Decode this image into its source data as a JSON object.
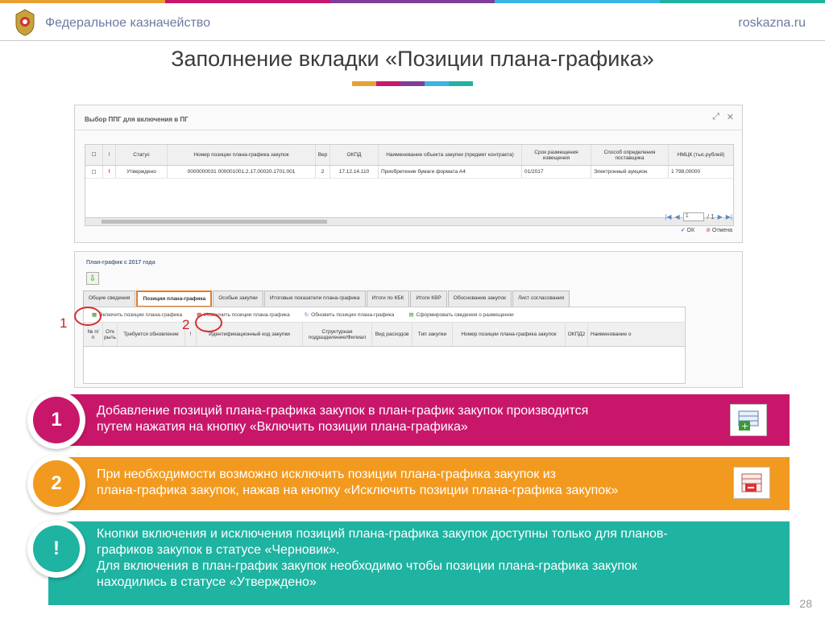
{
  "header": {
    "org_name": "Федеральное казначейство",
    "site_url": "roskazna.ru",
    "logo_icon": "coat-of-arms-emblem",
    "accent_colors": [
      "#e8a035",
      "#c8176b",
      "#7f3f98",
      "#3ab5e6",
      "#1fb3a1"
    ]
  },
  "slide": {
    "title": "Заполнение вкладки «Позиции плана-графика»",
    "page_number": "28"
  },
  "dialog": {
    "title": "Выбор ППГ для включения в ПГ",
    "columns": [
      "",
      "!",
      "Статус",
      "Номер позиции плана-графика закупок",
      "Вер",
      "ОКПД",
      "Наименование объекта закупки (предмет контракта)",
      "Срок размещения извещения",
      "Способ определения поставщика",
      "НМЦК (тыс.рублей)"
    ],
    "rows": [
      [
        "",
        "!",
        "Утверждено",
        "0000000031 000001001.2.17.00020.1701.001",
        "2",
        "17.12.14.110",
        "Приобретение бумаги формата А4",
        "01/2017",
        "Электронный аукцион",
        "1 798,00000"
      ]
    ],
    "pager": {
      "page": "1",
      "of": "/ 1"
    },
    "ok_label": "ОК",
    "cancel_label": "Отмена"
  },
  "form": {
    "title": "План-график с 2017 года",
    "tabs": [
      "Общие сведения",
      "Позиции плана-графика",
      "Особые закупки",
      "Итоговые показатели плана-графика",
      "Итоги по КБК",
      "Итоги КВР",
      "Обоснование закупок",
      "Лист согласования"
    ],
    "active_tab": 1,
    "toolbar": [
      "Включить позиции плана-графика",
      "Исключить позиции плана-графика",
      "Обновить позиции плана-графика",
      "Сформировать сведения о размещении"
    ],
    "columns": [
      "№ п/п",
      "Отк рыть",
      "Требуется обновление",
      "!",
      "Идентификационный код закупки",
      "Структурная подразделение/Филиал",
      "Вид расходов",
      "Тип закупки",
      "Номер позиции плана-графика закупок",
      "ОКПД2",
      "Наименование о"
    ],
    "markers": [
      "1",
      "2"
    ]
  },
  "bands": [
    {
      "badge": "1",
      "color": "#c8176b",
      "lines": [
        "Добавление позиций плана-графика закупок в план-график закупок производится",
        "путем нажатия на кнопку «Включить позиции плана-графика»"
      ],
      "icon": "add-rows-icon"
    },
    {
      "badge": "2",
      "color": "#f29a1f",
      "lines": [
        "При необходимости возможно исключить позиции плана-графика закупок из",
        "плана-графика закупок, нажав на кнопку «Исключить позиции плана-графика закупок»"
      ],
      "icon": "remove-rows-icon"
    },
    {
      "badge": "!",
      "color": "#1fb3a1",
      "lines": [
        "Кнопки включения и исключения позиций плана-графика закупок доступны только для планов-",
        "графиков закупок в статусе «Черновик».",
        "Для включения в план-график закупок необходимо чтобы позиции плана-графика закупок",
        "находились в статусе «Утверждено»"
      ]
    }
  ]
}
